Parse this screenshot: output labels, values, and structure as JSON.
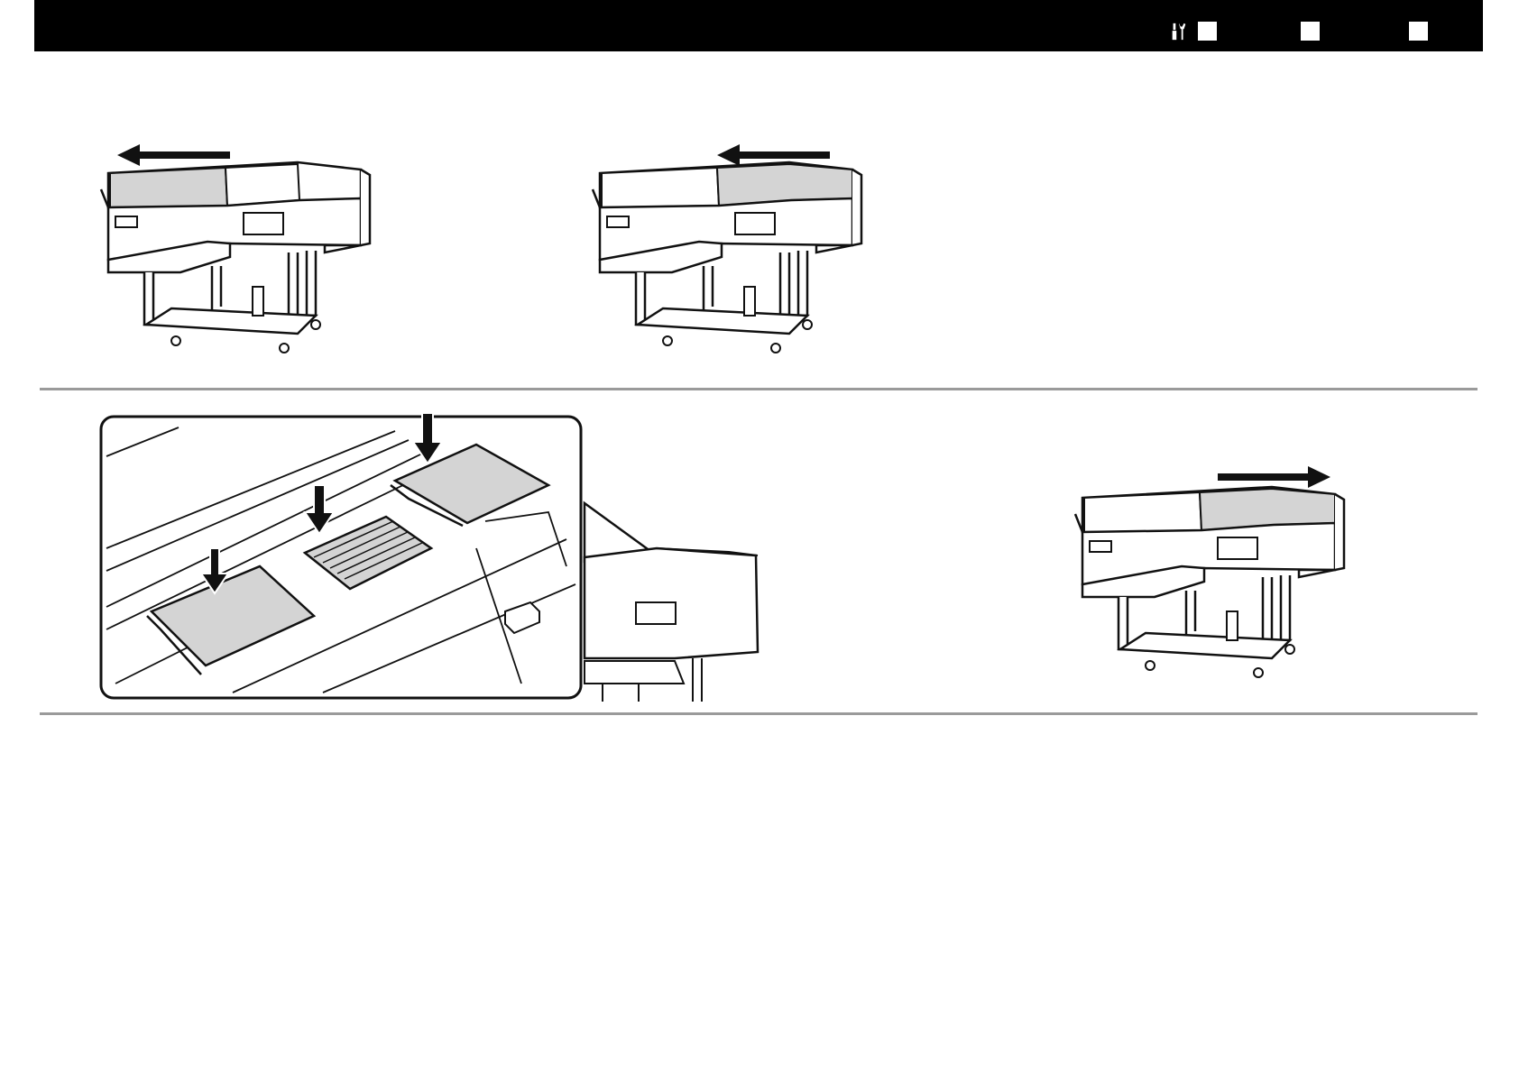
{
  "header": {
    "tool_icon": "maintenance-wrench-screwdriver-icon",
    "nav_boxes": [
      "nav-box-1",
      "nav-box-2",
      "nav-box-3"
    ]
  },
  "illustrations": [
    {
      "name": "printer-left-cover-open-left-arrow",
      "shaded_cover": "left",
      "arrow": "left"
    },
    {
      "name": "printer-right-cover-open-left-arrow",
      "shaded_cover": "right",
      "arrow": "left"
    },
    {
      "name": "cap-cleaning-pads-insert-detail",
      "arrows": "down",
      "pads": 3
    },
    {
      "name": "printer-right-cover-close-right-arrow",
      "shaded_cover": "right",
      "arrow": "right"
    }
  ],
  "colors": {
    "bar": "#000000",
    "separator": "#9a9a9a",
    "shade": "#d4d4d4",
    "line": "#111111"
  }
}
